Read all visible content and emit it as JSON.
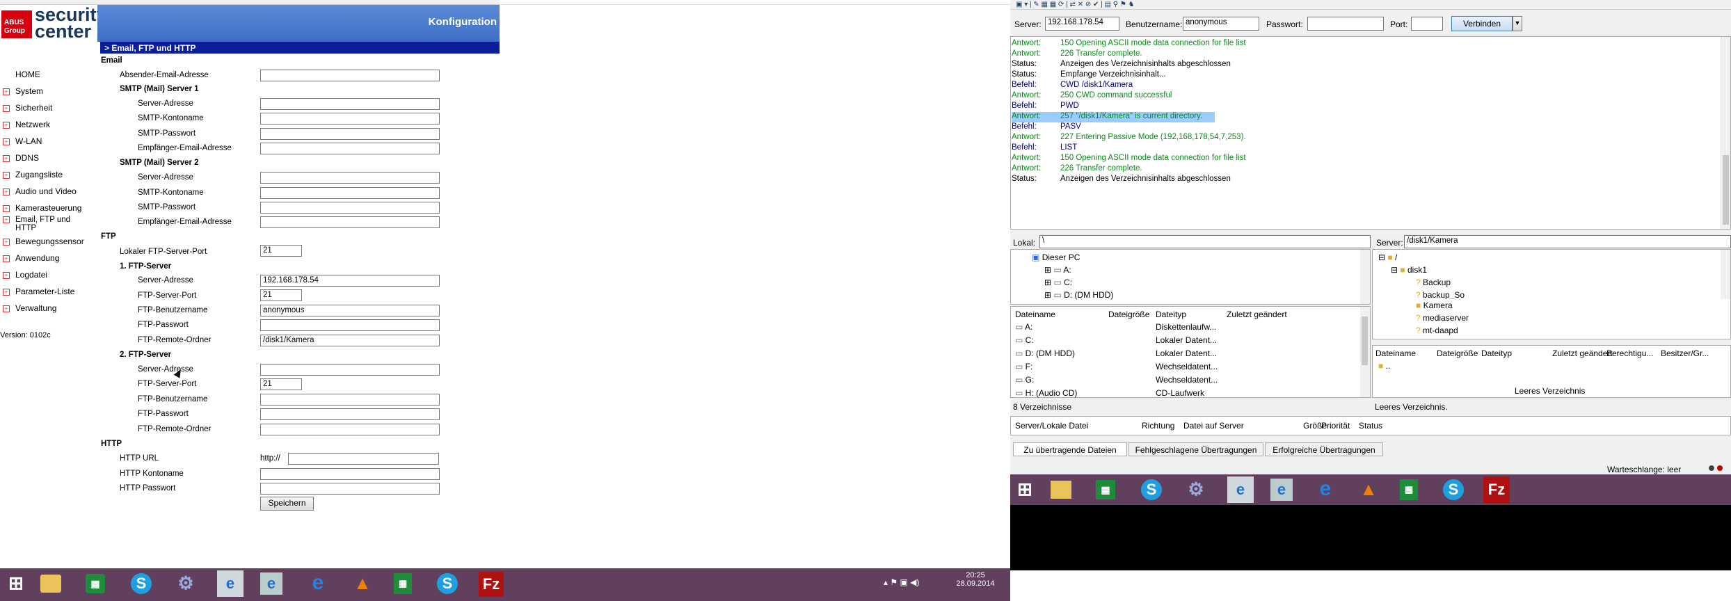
{
  "abus": {
    "brand_red": "ABUS Group",
    "brand_text_1": "security",
    "brand_text_2": "center",
    "header_title": "Konfiguration",
    "section_title": "> Email, FTP und HTTP",
    "nav": [
      "HOME",
      "System",
      "Sicherheit",
      "Netzwerk",
      "W-LAN",
      "DDNS",
      "Zugangsliste",
      "Audio und Video",
      "Kamerasteuerung",
      "Email, FTP und HTTP",
      "Bewegungssensor",
      "Anwendung",
      "Logdatei",
      "Parameter-Liste",
      "Verwaltung"
    ],
    "version": "Version: 0102c",
    "email_title": "Email",
    "sender_label": "Absender-Email-Adresse",
    "smtp1_title": "SMTP (Mail) Server 1",
    "smtp2_title": "SMTP (Mail) Server 2",
    "server_address": "Server-Adresse",
    "smtp_account": "SMTP-Kontoname",
    "smtp_password": "SMTP-Passwort",
    "recipient": "Empfänger-Email-Adresse",
    "ftp_title": "FTP",
    "local_ftp_port": "Lokaler FTP-Server-Port",
    "local_ftp_port_value": "21",
    "ftp1_title": "1. FTP-Server",
    "ftp2_title": "2. FTP-Server",
    "ftp_port": "FTP-Server-Port",
    "ftp_user": "FTP-Benutzername",
    "ftp_pass": "FTP-Passwort",
    "ftp_remote": "FTP-Remote-Ordner",
    "ftp1_server_value": "192.168.178.54",
    "ftp1_port_value": "21",
    "ftp1_user_value": "anonymous",
    "ftp1_remote_value": "/disk1/Kamera",
    "ftp2_port_value": "21",
    "http_title": "HTTP",
    "http_url": "HTTP URL",
    "http_url_prefix": "http://",
    "http_account": "HTTP Kontoname",
    "http_password": "HTTP Passwort",
    "save": "Speichern"
  },
  "taskbar_left": {
    "time": "20:25",
    "date": "28.09.2014"
  },
  "filezilla": {
    "server_label": "Server:",
    "server_value": "192.168.178.54",
    "user_label": "Benutzername:",
    "user_value": "anonymous",
    "pass_label": "Passwort:",
    "port_label": "Port:",
    "connect": "Verbinden",
    "log": [
      {
        "k": "Antwort:",
        "v": "150 Opening ASCII mode data connection for file list",
        "c": "green"
      },
      {
        "k": "Antwort:",
        "v": "226 Transfer complete.",
        "c": "green"
      },
      {
        "k": "Status:",
        "v": "Anzeigen des Verzeichnisinhalts abgeschlossen",
        "c": "black"
      },
      {
        "k": "Status:",
        "v": "Empfange Verzeichnisinhalt...",
        "c": "black"
      },
      {
        "k": "Befehl:",
        "v": "CWD /disk1/Kamera",
        "c": "navy"
      },
      {
        "k": "Antwort:",
        "v": "250 CWD command successful",
        "c": "green"
      },
      {
        "k": "Befehl:",
        "v": "PWD",
        "c": "navy"
      },
      {
        "k": "Antwort:",
        "v": "257 \"/disk1/Kamera\" is current directory.",
        "c": "sel"
      },
      {
        "k": "Befehl:",
        "v": "PASV",
        "c": "navy"
      },
      {
        "k": "Antwort:",
        "v": "227 Entering Passive Mode (192,168,178,54,7,253).",
        "c": "green"
      },
      {
        "k": "Befehl:",
        "v": "LIST",
        "c": "navy"
      },
      {
        "k": "Antwort:",
        "v": "150 Opening ASCII mode data connection for file list",
        "c": "green"
      },
      {
        "k": "Antwort:",
        "v": "226 Transfer complete.",
        "c": "green"
      },
      {
        "k": "Status:",
        "v": "Anzeigen des Verzeichnisinhalts abgeschlossen",
        "c": "black"
      }
    ],
    "local_label": "Lokal:",
    "local_value": "\\",
    "remote_label": "Server:",
    "remote_value": "/disk1/Kamera",
    "local_tree": [
      "Dieser PC",
      "A:",
      "C:",
      "D: (DM HDD)"
    ],
    "remote_tree": [
      "/",
      "disk1",
      "Backup",
      "backup_So",
      "Kamera",
      "mediaserver",
      "mt-daapd"
    ],
    "local_cols": [
      "Dateiname",
      "Dateigröße",
      "Dateityp",
      "Zuletzt geändert"
    ],
    "local_files": [
      {
        "name": "A:",
        "type": "Diskettenlaufw..."
      },
      {
        "name": "C:",
        "type": "Lokaler Datent..."
      },
      {
        "name": "D: (DM HDD)",
        "type": "Lokaler Datent..."
      },
      {
        "name": "F:",
        "type": "Wechseldatent..."
      },
      {
        "name": "G:",
        "type": "Wechseldatent..."
      },
      {
        "name": "H: (Audio CD)",
        "type": "CD-Laufwerk"
      }
    ],
    "local_status": "8 Verzeichnisse",
    "remote_cols": [
      "Dateiname",
      "Dateigröße",
      "Dateityp",
      "Zuletzt geändert",
      "Berechtigu...",
      "Besitzer/Gr..."
    ],
    "remote_up": "..",
    "remote_empty": "Leeres Verzeichnis",
    "remote_status": "Leeres Verzeichnis.",
    "queue_cols": [
      "Server/Lokale Datei",
      "Richtung",
      "Datei auf Server",
      "Größe",
      "Priorität",
      "Status"
    ],
    "tabs": [
      "Zu übertragende Dateien",
      "Fehlgeschlagene Übertragungen",
      "Erfolgreiche Übertragungen"
    ],
    "queue_status": "Warteschlange: leer"
  }
}
